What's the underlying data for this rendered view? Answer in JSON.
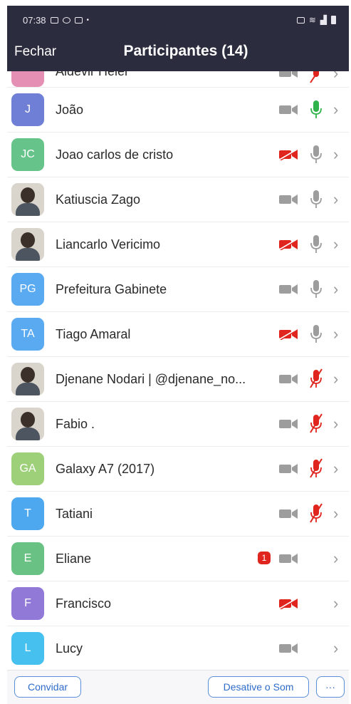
{
  "status": {
    "time": "07:38"
  },
  "header": {
    "close_label": "Fechar",
    "title": "Participantes (14)"
  },
  "partial": {
    "name": "Aldevir Heier"
  },
  "participants": [
    {
      "name": "João",
      "initials": "J",
      "color": "#6f7fd6",
      "camera": "off",
      "mic": "active",
      "photo": false
    },
    {
      "name": "Joao carlos de cristo",
      "initials": "JC",
      "color": "#66c48a",
      "camera": "red",
      "mic": "gray",
      "photo": false
    },
    {
      "name": "Katiuscia Zago",
      "initials": "",
      "color": "",
      "camera": "off",
      "mic": "gray",
      "photo": true
    },
    {
      "name": "Liancarlo Vericimo",
      "initials": "",
      "color": "",
      "camera": "red",
      "mic": "gray",
      "photo": true
    },
    {
      "name": "Prefeitura Gabinete",
      "initials": "PG",
      "color": "#5aaaf2",
      "camera": "off",
      "mic": "gray",
      "photo": false
    },
    {
      "name": "Tiago Amaral",
      "initials": "TA",
      "color": "#5aaaf2",
      "camera": "red",
      "mic": "gray",
      "photo": false
    },
    {
      "name": "Djenane Nodari | @djenane_no...",
      "initials": "",
      "color": "",
      "camera": "off",
      "mic": "muted",
      "photo": true
    },
    {
      "name": "Fabio .",
      "initials": "",
      "color": "",
      "camera": "off",
      "mic": "muted",
      "photo": true
    },
    {
      "name": "Galaxy A7 (2017)",
      "initials": "GA",
      "color": "#9ed07a",
      "camera": "off",
      "mic": "muted",
      "photo": false
    },
    {
      "name": "Tatiani",
      "initials": "T",
      "color": "#4ea8ef",
      "camera": "off",
      "mic": "muted",
      "photo": false
    },
    {
      "name": "Eliane",
      "initials": "E",
      "color": "#69c283",
      "camera": "off",
      "mic": "none",
      "photo": false,
      "badge": "1"
    },
    {
      "name": "Francisco",
      "initials": "F",
      "color": "#9179d8",
      "camera": "red",
      "mic": "none",
      "photo": false
    },
    {
      "name": "Lucy",
      "initials": "L",
      "color": "#46c0ee",
      "camera": "off",
      "mic": "none",
      "photo": false
    }
  ],
  "footer": {
    "invite_label": "Convidar",
    "mute_all_label": "Desative o Som",
    "more_label": "···"
  },
  "colors": {
    "header_bg": "#2b2c3e",
    "mic_active": "#2fb34a",
    "red": "#e0251e",
    "accent": "#2d6bc9"
  }
}
